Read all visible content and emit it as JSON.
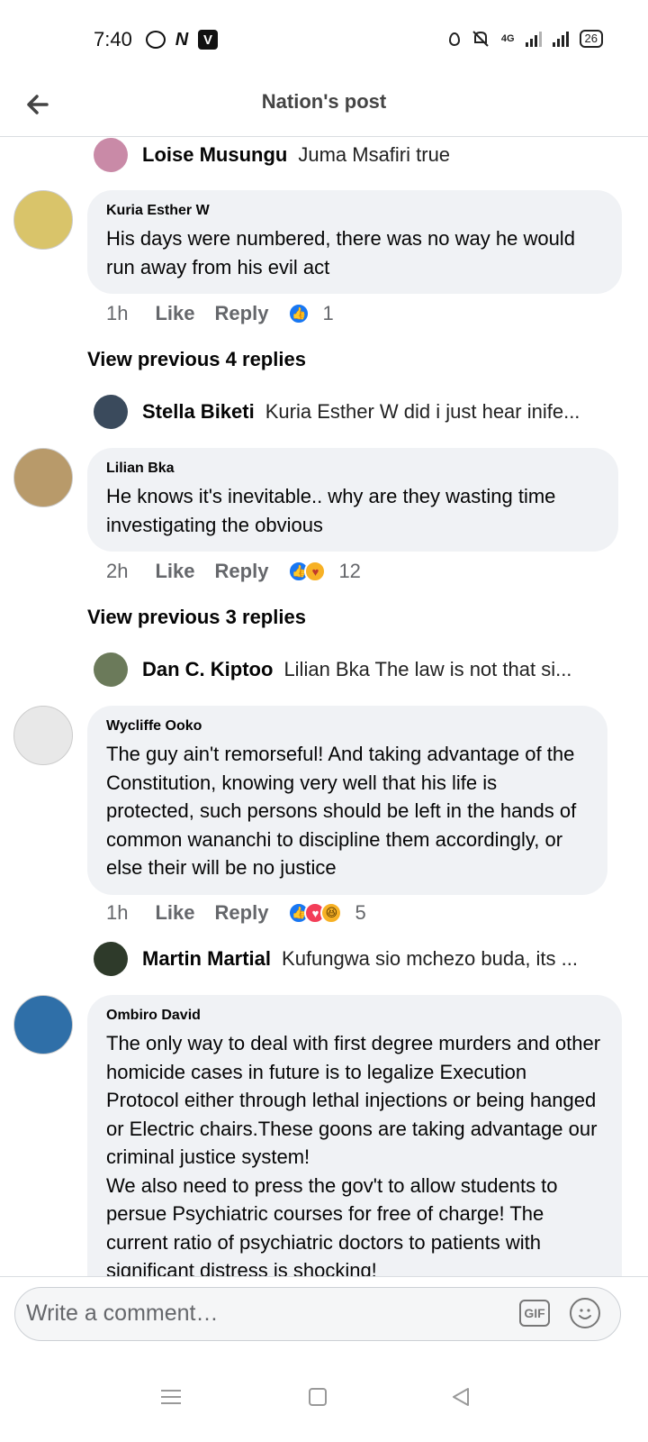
{
  "status_bar": {
    "time": "7:40",
    "network": "4G",
    "battery": "26"
  },
  "header": {
    "title": "Nation's post"
  },
  "comments": [
    {
      "type": "reply_preview",
      "name": "Loise Musungu",
      "text": "Juma Msafiri true",
      "avatar_color": "#c98aa7"
    },
    {
      "type": "comment",
      "author": "Kuria Esther W",
      "text": "His days were numbered, there was no way he would run away from his evil act",
      "time": "1h",
      "like": "Like",
      "reply": "Reply",
      "reaction_count": "1",
      "avatar_color": "#d9c46a"
    },
    {
      "type": "view_previous",
      "label": "View previous 4 replies"
    },
    {
      "type": "reply_preview",
      "name": "Stella Biketi",
      "text": "Kuria Esther W did i just hear inife...",
      "avatar_color": "#3a4a5c"
    },
    {
      "type": "comment",
      "author": "Lilian Bka",
      "text": "He knows it's  inevitable.. why are they  wasting time investigating the obvious",
      "time": "2h",
      "like": "Like",
      "reply": "Reply",
      "reaction_count": "12",
      "avatar_color": "#b89a6a"
    },
    {
      "type": "view_previous",
      "label": "View previous 3 replies"
    },
    {
      "type": "reply_preview",
      "name": "Dan C. Kiptoo",
      "text": "Lilian Bka The law is not that si...",
      "avatar_color": "#6b7a5a"
    },
    {
      "type": "comment",
      "author": "Wycliffe Ooko",
      "text": "The guy ain't remorseful! And taking advantage of the Constitution, knowing very well that his life is protected, such persons should be left in the hands of common wananchi to discipline them accordingly, or else their will be no justice",
      "time": "1h",
      "like": "Like",
      "reply": "Reply",
      "reaction_count": "5",
      "avatar_color": "#e8e8e8"
    },
    {
      "type": "reply_preview",
      "name": "Martin Martial",
      "text": "Kufungwa sio mchezo buda, its ...",
      "avatar_color": "#2e3a2a"
    },
    {
      "type": "comment",
      "author": "Ombiro David",
      "text": "The only way to deal with first degree murders and other homicide cases in future is to legalize Execution Protocol either through lethal injections or being hanged or Electric chairs.These goons are taking advantage our criminal justice system!\nWe also need to press the gov't to allow students to persue Psychiatric courses for free of charge! The current ratio of psychiatric doctors to patients with significant distress is shocking!",
      "avatar_color": "#2f6fa8"
    }
  ],
  "composer": {
    "placeholder": "Write a comment…",
    "gif_label": "GIF"
  },
  "icons": {
    "back": "arrow-left-icon",
    "gif": "gif-icon",
    "emoji": "emoji-icon",
    "nav_recents": "menu-icon",
    "nav_home": "square-icon",
    "nav_back": "triangle-back-icon"
  },
  "colors": {
    "bubble": "#f0f2f5",
    "like_blue": "#1877f2",
    "love_red": "#f33e58",
    "haha_yellow": "#f7b125",
    "meta_gray": "#65676b"
  }
}
